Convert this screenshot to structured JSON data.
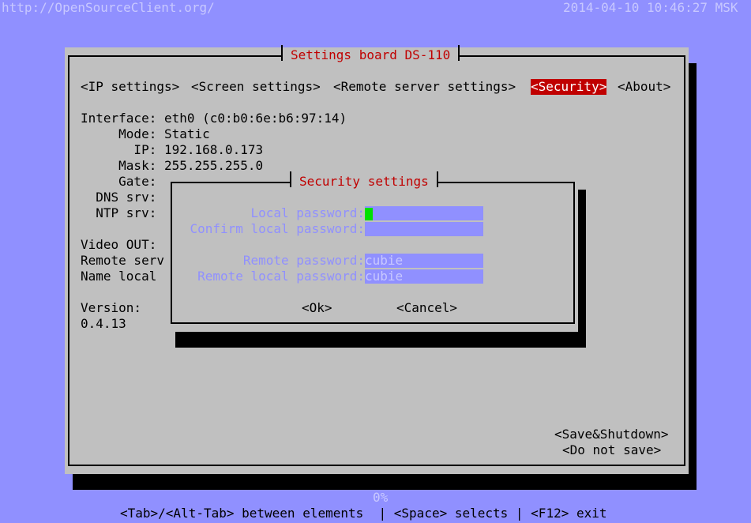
{
  "top_bar": {
    "url": "http://OpenSourceClient.org/",
    "datetime": "2014-04-10 10:46:27 MSK"
  },
  "main": {
    "title": "Settings board DS-110",
    "tabs": [
      {
        "label": "<IP settings>"
      },
      {
        "label": "<Screen settings>"
      },
      {
        "label": "<Remote server settings>"
      },
      {
        "label": "<Security>",
        "selected": true
      },
      {
        "label": "<About>"
      }
    ],
    "info": {
      "interface": "Interface: eth0 (c0:b0:6e:b6:97:14)",
      "mode": "     Mode: Static",
      "ip": "       IP: 192.168.0.173",
      "mask": "     Mask: 255.255.255.0",
      "gate": "     Gate:",
      "dns": "  DNS srv:",
      "ntp": "  NTP srv:",
      "video": "Video OUT:",
      "remote": "Remote serv",
      "name": "Name local",
      "version_label": "Version:",
      "version_value": "0.4.13"
    },
    "save_shutdown": "<Save&Shutdown>",
    "do_not_save": "<Do not save>"
  },
  "dialog": {
    "title": "Security settings",
    "local_password_label": "Local password:",
    "local_password_value": "",
    "confirm_password_label": "Confirm local password:",
    "confirm_password_value": "",
    "remote_password_label": "Remote password:",
    "remote_password_value": "cubie",
    "remote_local_password_label": "Remote local password:",
    "remote_local_password_value": "cubie",
    "ok": "<Ok>",
    "cancel": "<Cancel>"
  },
  "status": {
    "progress": "0%",
    "help": "<Tab>/<Alt-Tab> between elements  | <Space> selects | <F12> exit"
  },
  "colors": {
    "background": "#9090ff",
    "panel": "#c0c0c0",
    "accent": "#c00000",
    "cursor": "#00e000"
  }
}
